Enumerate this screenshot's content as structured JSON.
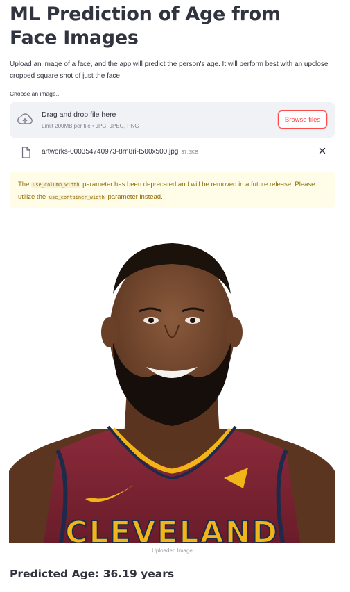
{
  "page": {
    "title": "ML Prediction of Age from Face Images",
    "description": "Upload an image of a face, and the app will predict the person's age. It will perform best with an upclose cropped square shot of just the face"
  },
  "uploader": {
    "label": "Choose an image...",
    "drop_text": "Drag and drop file here",
    "limit_text": "Limit 200MB per file • JPG, JPEG, PNG",
    "browse_label": "Browse files",
    "icon": "cloud-upload-icon"
  },
  "uploaded_file": {
    "name": "artworks-000354740973-8rn8ri-t500x500.jpg",
    "size": "37.5KB",
    "icon": "file-icon"
  },
  "warning": {
    "text_1": "The ",
    "code_1": "use_column_width",
    "text_2": " parameter has been deprecated and will be removed in a future release. Please utilize the ",
    "code_2": "use_container_width",
    "text_3": " parameter instead."
  },
  "image": {
    "caption": "Uploaded Image",
    "jersey_text": "CLEVELAND"
  },
  "result": {
    "text": "Predicted Age: 36.19 years"
  },
  "colors": {
    "primary": "#ff4b4b",
    "text": "#31333f",
    "dropzone_bg": "#f0f2f6",
    "warning_bg": "#fffce7",
    "warning_text": "#926c05",
    "jersey": "#7a2233",
    "jersey_gold": "#f2b519"
  }
}
